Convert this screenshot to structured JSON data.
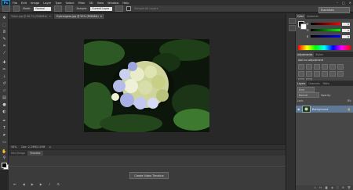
{
  "app": {
    "logo": "Ps"
  },
  "menu": [
    "File",
    "Edit",
    "Image",
    "Layer",
    "Type",
    "Select",
    "Filter",
    "3D",
    "View",
    "Window",
    "Help"
  ],
  "window_controls": [
    "–",
    "□",
    "✕"
  ],
  "options_bar": {
    "mode_label": "Mode:",
    "mode_value": "Normal",
    "opacity_label": "Opacity:",
    "flow_label": "Flow:",
    "sample_label": "Sample:",
    "sample_value": "Current Layer",
    "ignore_label": "Sample All Layers",
    "workspace": "Essentials"
  },
  "documents": [
    {
      "title": "Tulips.jpg @ 66.7% (RGB/8#)",
      "active": false
    },
    {
      "title": "Hydrangeas.jpg @ 50% (RGB/8#)",
      "active": true
    }
  ],
  "status": {
    "zoom": "50%",
    "doc": "Doc: 2.29M/2.29M"
  },
  "bottom_tabs": [
    "Mini Bridge",
    "Timeline"
  ],
  "timeline": {
    "create_button": "Create Video Timeline"
  },
  "color_panel": {
    "tabs": [
      "Color",
      "Swatches"
    ],
    "sliders": [
      {
        "label": "R",
        "value": "0"
      },
      {
        "label": "G",
        "value": "0"
      },
      {
        "label": "B",
        "value": "0"
      }
    ]
  },
  "adjustments_panel": {
    "tabs": [
      "Adjustments",
      "Styles"
    ],
    "title": "Add an adjustment"
  },
  "layers_panel": {
    "tabs": [
      "Layers",
      "Channels",
      "Paths"
    ],
    "kind_label": "Kind",
    "blend_mode": "Normal",
    "opacity_label": "Opacity:",
    "lock_label": "Lock:",
    "fill_label": "Fill:",
    "layer_name": "Background"
  },
  "colors": {
    "accent": "#3fa9f5",
    "selected_layer": "#5e7896"
  }
}
